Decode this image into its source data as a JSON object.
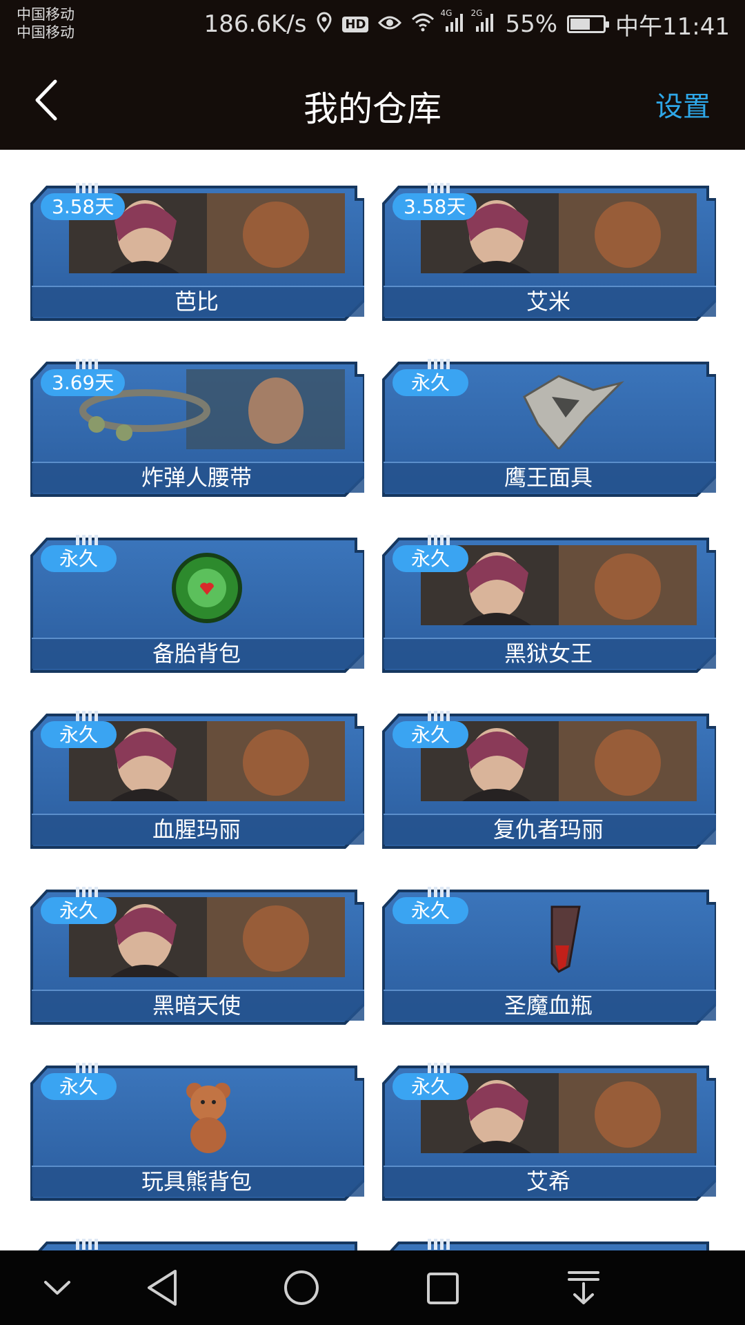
{
  "status_bar": {
    "carrier_1": "中国移动",
    "carrier_2": "中国移动",
    "net_speed": "186.6K/s",
    "hd": "HD",
    "net_4g": "4G",
    "net_2g": "2G",
    "battery_percent": "55%",
    "battery_level": 0.55,
    "time": "中午11:41"
  },
  "header": {
    "title": "我的仓库",
    "settings_label": "设置"
  },
  "colors": {
    "bar_bg": "#140d0a",
    "accent": "#2ea7e8",
    "badge": "#3aa4f2",
    "card_blue": "#2f64a8"
  },
  "items": [
    {
      "name": "芭比",
      "duration": "3.58天",
      "art": "character-portrait"
    },
    {
      "name": "艾米",
      "duration": "3.58天",
      "art": "character-portrait"
    },
    {
      "name": "炸弹人腰带",
      "duration": "3.69天",
      "art": "belt-item"
    },
    {
      "name": "鹰王面具",
      "duration": "永久",
      "art": "mask-item"
    },
    {
      "name": "备胎背包",
      "duration": "永久",
      "art": "tire-backpack"
    },
    {
      "name": "黑狱女王",
      "duration": "永久",
      "art": "character-portrait"
    },
    {
      "name": "血腥玛丽",
      "duration": "永久",
      "art": "character-portrait"
    },
    {
      "name": "复仇者玛丽",
      "duration": "永久",
      "art": "character-portrait"
    },
    {
      "name": "黑暗天使",
      "duration": "永久",
      "art": "character-portrait"
    },
    {
      "name": "圣魔血瓶",
      "duration": "永久",
      "art": "blood-vial"
    },
    {
      "name": "玩具熊背包",
      "duration": "永久",
      "art": "teddy-bear-backpack"
    },
    {
      "name": "艾希",
      "duration": "永久",
      "art": "character-portrait"
    }
  ],
  "nav": {
    "icons": [
      "chevron-down-icon",
      "back-triangle-icon",
      "home-circle-icon",
      "recent-square-icon",
      "download-icon"
    ]
  }
}
